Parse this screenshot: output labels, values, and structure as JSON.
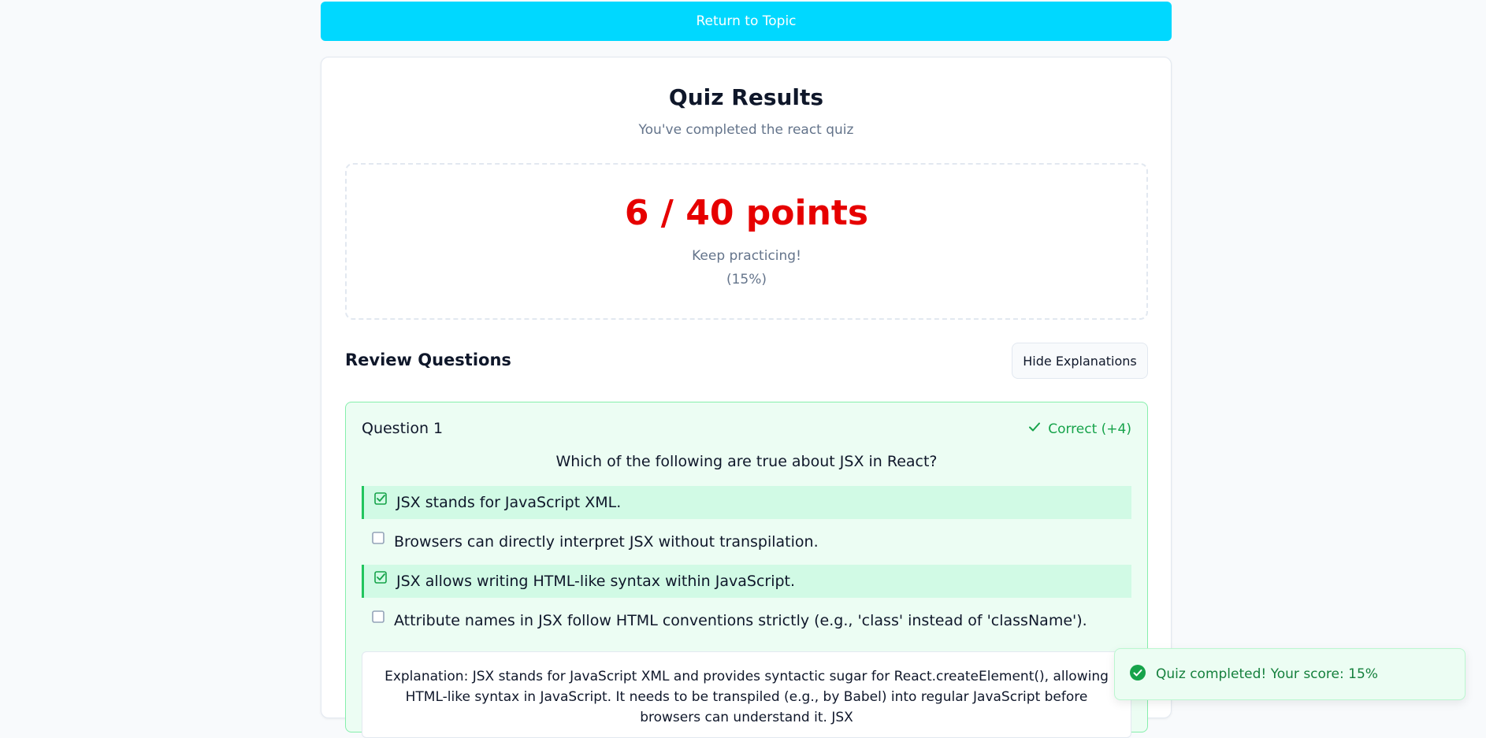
{
  "header": {
    "return_label": "Return to Topic"
  },
  "results": {
    "title": "Quiz Results",
    "subtitle": "You've completed the react quiz",
    "score_text": "6 / 40 points",
    "message": "Keep practicing!",
    "percent_text": "(15%)"
  },
  "review": {
    "heading": "Review Questions",
    "toggle_label": "Hide Explanations"
  },
  "question": {
    "number_label": "Question 1",
    "status_label": "Correct (+4)",
    "text": "Which of the following are true about JSX in React?",
    "options": [
      {
        "label": "JSX stands for JavaScript XML.",
        "selected": true
      },
      {
        "label": "Browsers can directly interpret JSX without transpilation.",
        "selected": false
      },
      {
        "label": "JSX allows writing HTML-like syntax within JavaScript.",
        "selected": true
      },
      {
        "label": "Attribute names in JSX follow HTML conventions strictly (e.g., 'class' instead of 'className').",
        "selected": false
      }
    ],
    "explanation": "Explanation: JSX stands for JavaScript XML and provides syntactic sugar for React.createElement(), allowing HTML-like syntax in JavaScript. It needs to be transpiled (e.g., by Babel) into regular JavaScript before browsers can understand it. JSX"
  },
  "toast": {
    "message": "Quiz completed! Your score: 15%"
  },
  "colors": {
    "accent": "#00d8ff",
    "score": "#e60000",
    "success": "#16a34a",
    "selected_bg": "#d1fae5"
  },
  "icons": {
    "status": "check-icon",
    "selected_option": "checkbox-checked-icon",
    "unselected_option": "checkbox-empty-icon",
    "toast": "check-circle-icon"
  }
}
